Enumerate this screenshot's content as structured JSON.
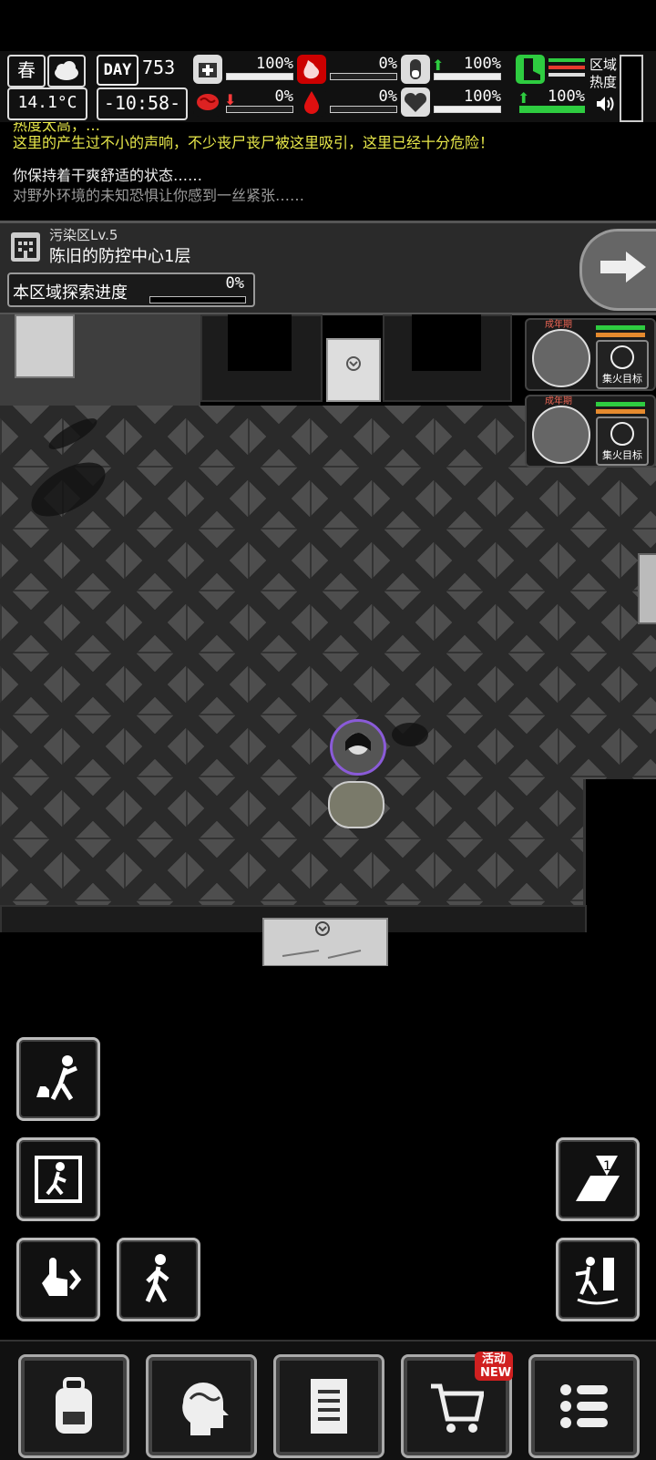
{
  "hud": {
    "season": "春",
    "temperature": "14.1°C",
    "day_label": "DAY",
    "day_number": "753",
    "time": "-10:58-",
    "stats": [
      {
        "name": "health",
        "value": "100%"
      },
      {
        "name": "hunger",
        "value": "0%"
      },
      {
        "name": "pill",
        "value": "100%"
      },
      {
        "name": "brain",
        "value": "0%"
      },
      {
        "name": "blood",
        "value": "0%"
      },
      {
        "name": "heart",
        "value": "100%"
      },
      {
        "name": "stamina",
        "value": "100%"
      }
    ],
    "region_heat": "区域热度"
  },
  "log": {
    "line0": "热度太高，…",
    "line1": "这里的产生过不小的声响，不少丧尸丧尸被这里吸引，这里已经十分危险！",
    "line2": "你保持着干爽舒适的状态……",
    "line3": "对野外环境的未知恐惧让你感到一丝紧张……"
  },
  "location": {
    "zone_level": "污染区Lv.5",
    "zone_name": "陈旧的防控中心1层",
    "explore_label": "本区域探索进度",
    "explore_progress": "0%"
  },
  "enemies": [
    {
      "stage": "成年期",
      "focus_label": "集火目标"
    },
    {
      "stage": "成年期",
      "focus_label": "集火目标"
    }
  ],
  "nav": {
    "shop_badge": "活动NEW"
  }
}
